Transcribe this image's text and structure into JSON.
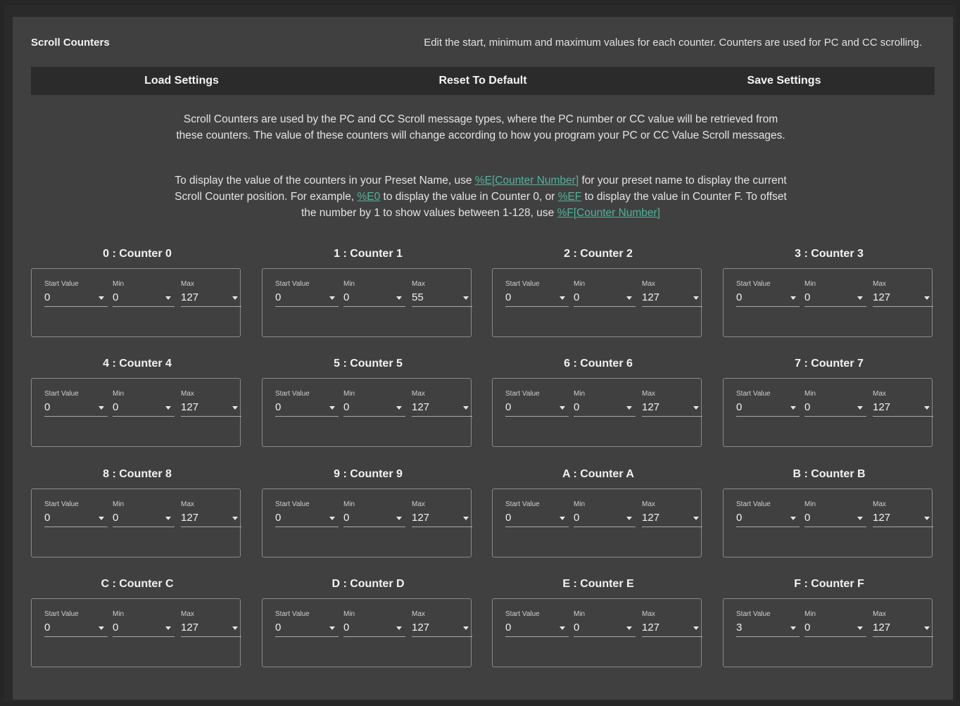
{
  "header": {
    "title": "Scroll Counters",
    "description": "Edit the start, minimum and maximum values for each counter. Counters are used for PC and CC scrolling."
  },
  "toolbar": {
    "load_label": "Load Settings",
    "reset_label": "Reset To Default",
    "save_label": "Save Settings"
  },
  "info": {
    "p1": "Scroll Counters are used by the PC and CC Scroll message types, where the PC number or CC value will be retrieved from these counters. The value of these counters will change according to how you program your PC or CC Value Scroll messages.",
    "p2_a": "To display the value of the counters in your Preset Name, use ",
    "p2_link1": "%E[Counter Number]",
    "p2_b": " for your preset name to display the current Scroll Counter position. For example, ",
    "p2_link2": "%E0",
    "p2_c": " to display the value in Counter 0, or ",
    "p2_link3": "%EF",
    "p2_d": " to display the value in Counter F. To offset the number by 1 to show values between 1-128, use ",
    "p2_link4": "%F[Counter Number]"
  },
  "field_labels": {
    "start": "Start Value",
    "min": "Min",
    "max": "Max"
  },
  "counters": [
    {
      "title": "0 : Counter 0",
      "start": "0",
      "min": "0",
      "max": "127"
    },
    {
      "title": "1 : Counter 1",
      "start": "0",
      "min": "0",
      "max": "55"
    },
    {
      "title": "2 : Counter 2",
      "start": "0",
      "min": "0",
      "max": "127"
    },
    {
      "title": "3 : Counter 3",
      "start": "0",
      "min": "0",
      "max": "127"
    },
    {
      "title": "4 : Counter 4",
      "start": "0",
      "min": "0",
      "max": "127"
    },
    {
      "title": "5 : Counter 5",
      "start": "0",
      "min": "0",
      "max": "127"
    },
    {
      "title": "6 : Counter 6",
      "start": "0",
      "min": "0",
      "max": "127"
    },
    {
      "title": "7 : Counter 7",
      "start": "0",
      "min": "0",
      "max": "127"
    },
    {
      "title": "8 : Counter 8",
      "start": "0",
      "min": "0",
      "max": "127"
    },
    {
      "title": "9 : Counter 9",
      "start": "0",
      "min": "0",
      "max": "127"
    },
    {
      "title": "A : Counter A",
      "start": "0",
      "min": "0",
      "max": "127"
    },
    {
      "title": "B : Counter B",
      "start": "0",
      "min": "0",
      "max": "127"
    },
    {
      "title": "C : Counter C",
      "start": "0",
      "min": "0",
      "max": "127"
    },
    {
      "title": "D : Counter D",
      "start": "0",
      "min": "0",
      "max": "127"
    },
    {
      "title": "E : Counter E",
      "start": "0",
      "min": "0",
      "max": "127"
    },
    {
      "title": "F : Counter F",
      "start": "3",
      "min": "0",
      "max": "127"
    }
  ],
  "colors": {
    "link": "#4fb39a",
    "panel": "#404040",
    "toolbar": "#2b2b2b"
  }
}
